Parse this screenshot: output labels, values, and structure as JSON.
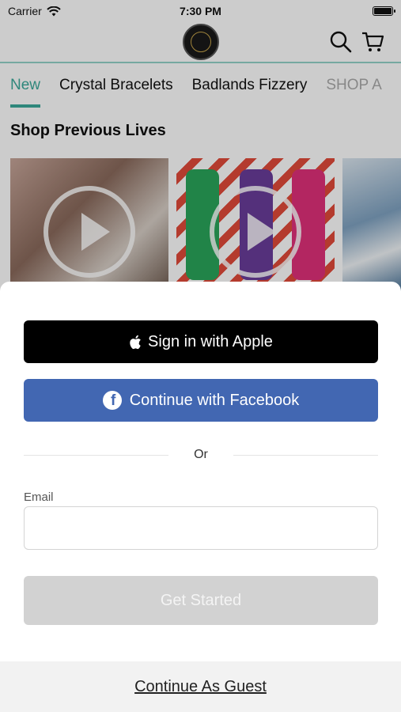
{
  "status_bar": {
    "carrier": "Carrier",
    "time": "7:30 PM"
  },
  "header": {
    "logo_icon": "store-logo",
    "search_icon": "search-icon",
    "cart_icon": "cart-icon",
    "accent_color": "#3aa99a"
  },
  "categories": [
    {
      "label": "New",
      "active": true
    },
    {
      "label": "Crystal Bracelets"
    },
    {
      "label": "Badlands Fizzery"
    },
    {
      "label": "SHOP A"
    }
  ],
  "section": {
    "title": "Shop Previous Lives"
  },
  "login_sheet": {
    "apple_label": "Sign in with Apple",
    "facebook_label": "Continue with Facebook",
    "facebook_color": "#4267b2",
    "or_label": "Or",
    "email_label": "Email",
    "email_value": "",
    "email_placeholder": "",
    "get_started_label": "Get Started",
    "guest_label": "Continue As Guest"
  }
}
